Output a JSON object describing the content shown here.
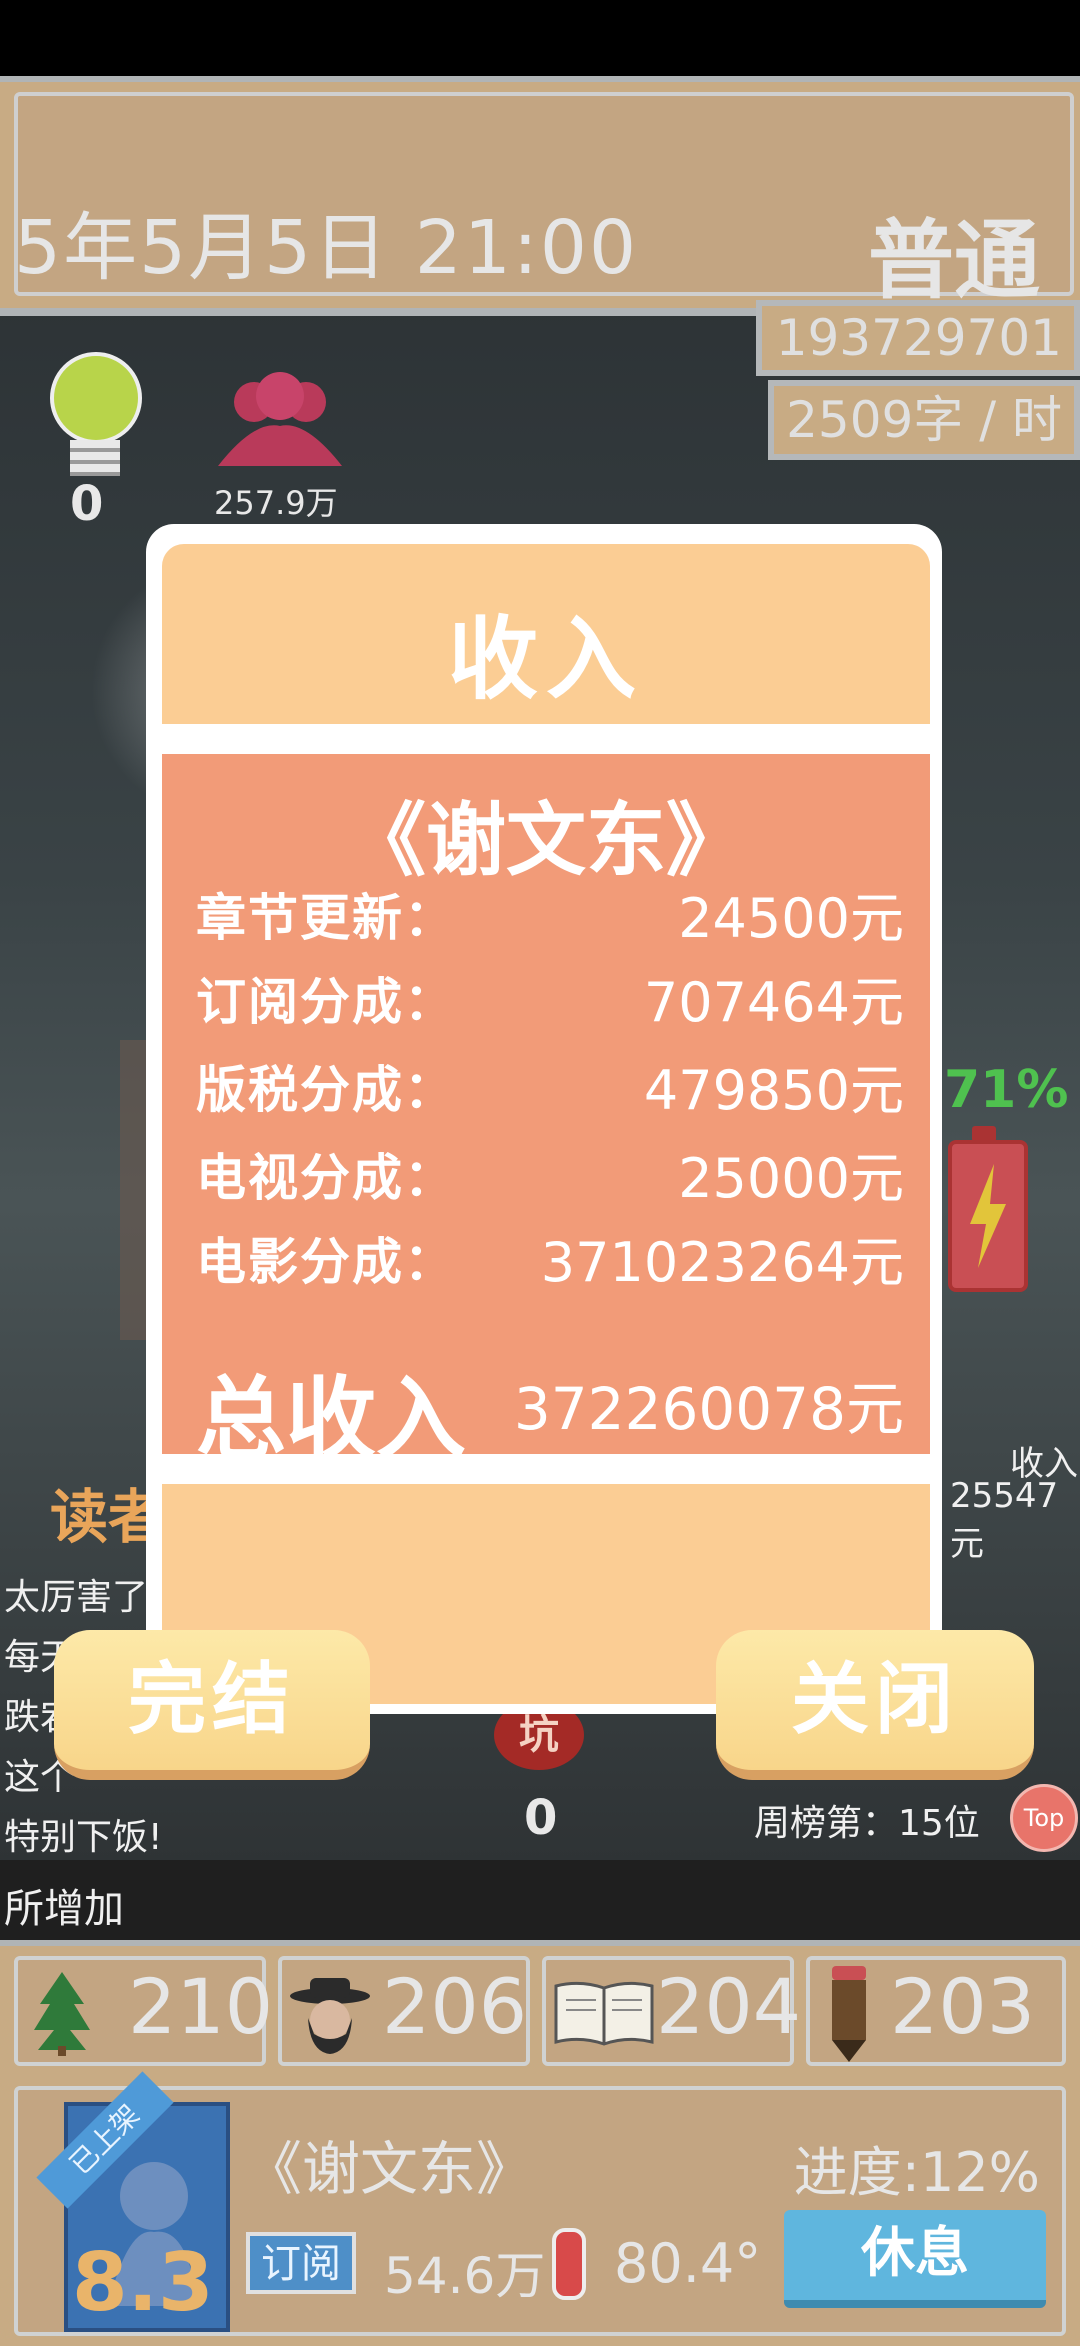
{
  "header": {
    "date_time": "5年5月5日  21:00",
    "mode": "普通",
    "money": "193729701元",
    "speed": "2509字 / 时"
  },
  "status": {
    "bulb_count": "0",
    "fans": "257.9万",
    "battery_percent": "71%",
    "pit_count": "0"
  },
  "reader": {
    "title": "读者",
    "comments": [
      "太厉害了",
      "每天",
      "跌宕",
      "这个",
      "特别下饭!"
    ],
    "added_text": "所增加"
  },
  "income_side": {
    "label": "收入",
    "value": "25547元",
    "weekly_rank": "周榜第：15位",
    "top_badge": "Top"
  },
  "modal": {
    "title": "收入",
    "book_title": "《谢文东》",
    "rows": [
      {
        "label": "章节更新：",
        "value": "24500元"
      },
      {
        "label": "订阅分成：",
        "value": "707464元"
      },
      {
        "label": "版税分成：",
        "value": "479850元"
      },
      {
        "label": "电视分成：",
        "value": "25000元"
      },
      {
        "label": "电影分成：",
        "value": "371023264元"
      }
    ],
    "total_label": "总收入",
    "total_value": "372260078元",
    "finish_button": "完结",
    "close_button": "关闭"
  },
  "bottom": {
    "stats": [
      {
        "icon": "tree-icon",
        "value": "210"
      },
      {
        "icon": "hat-person-icon",
        "value": "206"
      },
      {
        "icon": "book-icon",
        "value": "204"
      },
      {
        "icon": "pencil-icon",
        "value": "203"
      }
    ],
    "book": {
      "ribbon": "已上架",
      "score": "8.3",
      "name": "《谢文东》",
      "progress": "进度:12%",
      "subscribe_label": "订阅",
      "subscribe_count": "54.6万",
      "heat": "80.4°",
      "rest_button": "休息"
    }
  },
  "colors": {
    "header_bg": "#c8ab84",
    "modal_head": "#fbcd94",
    "modal_body": "#f29b78",
    "button": "#f8d58a",
    "rest_button": "#5fb6de"
  }
}
